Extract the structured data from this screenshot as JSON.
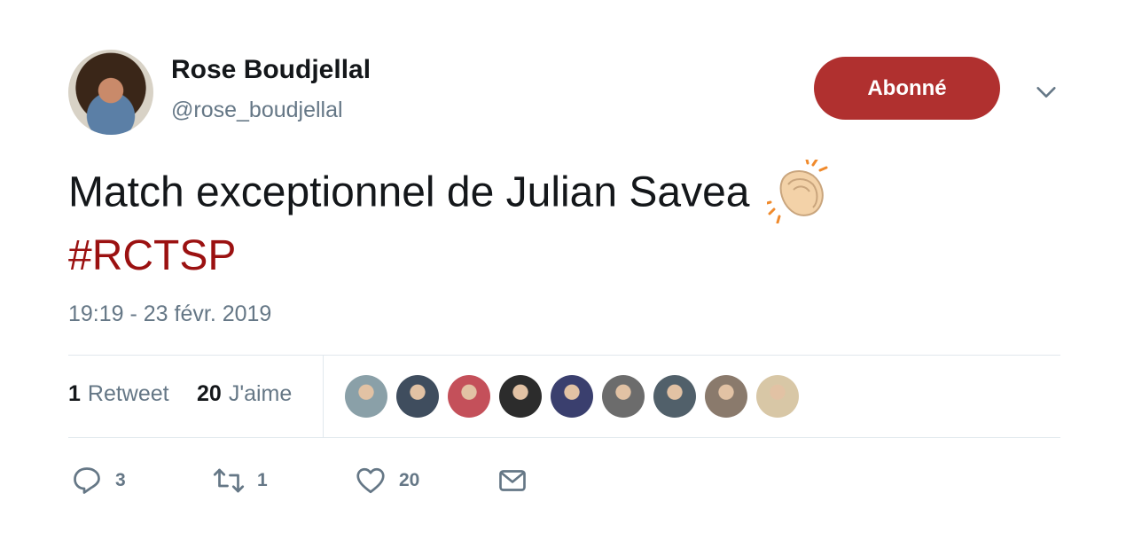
{
  "user": {
    "name": "Rose Boudjellal",
    "handle": "@rose_boudjellal"
  },
  "follow_button": {
    "label": "Abonné",
    "color": "#b0302f"
  },
  "tweet": {
    "text": "Match exceptionnel de Julian Savea",
    "emoji": "clapping-hands",
    "hashtag": "#RCTSP",
    "timestamp": "19:19 - 23 févr. 2019"
  },
  "stats": {
    "retweets_count": "1",
    "retweets_label": "Retweet",
    "likes_count": "20",
    "likes_label": "J'aime"
  },
  "likers": [
    {
      "color": "#8aa0a8"
    },
    {
      "color": "#3f4d5e"
    },
    {
      "color": "#c4505a"
    },
    {
      "color": "#2c2c2c"
    },
    {
      "color": "#3a3f6e"
    },
    {
      "color": "#6c6c6c"
    },
    {
      "color": "#51606a"
    },
    {
      "color": "#8a7a6c"
    },
    {
      "color": "#d8c7a6"
    }
  ],
  "actions": {
    "reply_count": "3",
    "retweet_count": "1",
    "like_count": "20"
  },
  "colors": {
    "hashtag": "#9b1111",
    "muted": "#657786"
  }
}
